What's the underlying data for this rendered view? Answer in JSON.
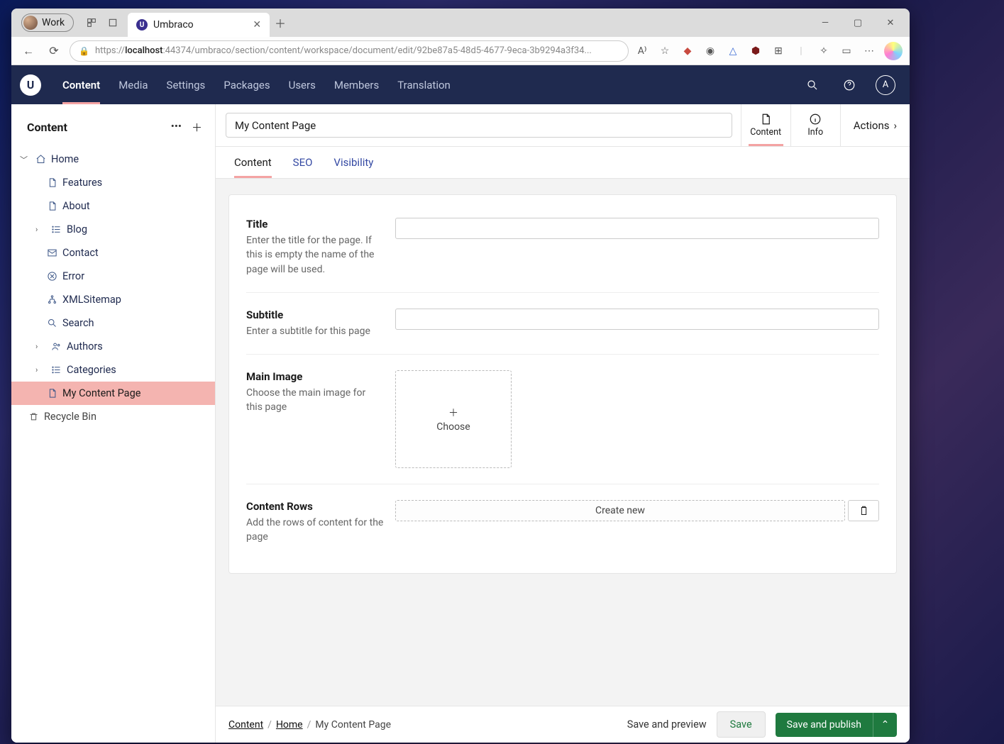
{
  "browser": {
    "profile_label": "Work",
    "tab_title": "Umbraco",
    "url_prefix": "https://",
    "url_host": "localhost",
    "url_rest": ":44374/umbraco/section/content/workspace/document/edit/92be87a5-48d5-4677-9eca-3b9294a3f34..."
  },
  "topnav": {
    "items": [
      "Content",
      "Media",
      "Settings",
      "Packages",
      "Users",
      "Members",
      "Translation"
    ],
    "active_index": 0,
    "avatar_letter": "A"
  },
  "sidebar": {
    "header": "Content",
    "tree": {
      "root": {
        "label": "Home"
      },
      "children": [
        {
          "label": "Features",
          "icon": "doc"
        },
        {
          "label": "About",
          "icon": "doc"
        },
        {
          "label": "Blog",
          "icon": "list",
          "expandable": true
        },
        {
          "label": "Contact",
          "icon": "mail"
        },
        {
          "label": "Error",
          "icon": "x"
        },
        {
          "label": "XMLSitemap",
          "icon": "sitemap"
        },
        {
          "label": "Search",
          "icon": "search"
        },
        {
          "label": "Authors",
          "icon": "people",
          "expandable": true
        },
        {
          "label": "Categories",
          "icon": "list",
          "expandable": true
        },
        {
          "label": "My Content Page",
          "icon": "doc",
          "selected": true
        }
      ]
    },
    "recycle": "Recycle Bin"
  },
  "workspace": {
    "name_value": "My Content Page",
    "apps": [
      {
        "label": "Content",
        "icon": "doc",
        "active": true
      },
      {
        "label": "Info",
        "icon": "info"
      }
    ],
    "actions": "Actions",
    "tabs": [
      "Content",
      "SEO",
      "Visibility"
    ],
    "active_tab": 0
  },
  "properties": [
    {
      "label": "Title",
      "description": "Enter the title for the page. If this is empty the name of the page will be used.",
      "editor": "text"
    },
    {
      "label": "Subtitle",
      "description": "Enter a subtitle for this page",
      "editor": "text"
    },
    {
      "label": "Main Image",
      "description": "Choose the main image for this page",
      "editor": "image",
      "choose_label": "Choose"
    },
    {
      "label": "Content Rows",
      "description": "Add the rows of content for the page",
      "editor": "rows",
      "create_label": "Create new"
    }
  ],
  "footer": {
    "breadcrumb": [
      "Content",
      "Home",
      "My Content Page"
    ],
    "save_preview": "Save and preview",
    "save": "Save",
    "publish": "Save and publish"
  }
}
